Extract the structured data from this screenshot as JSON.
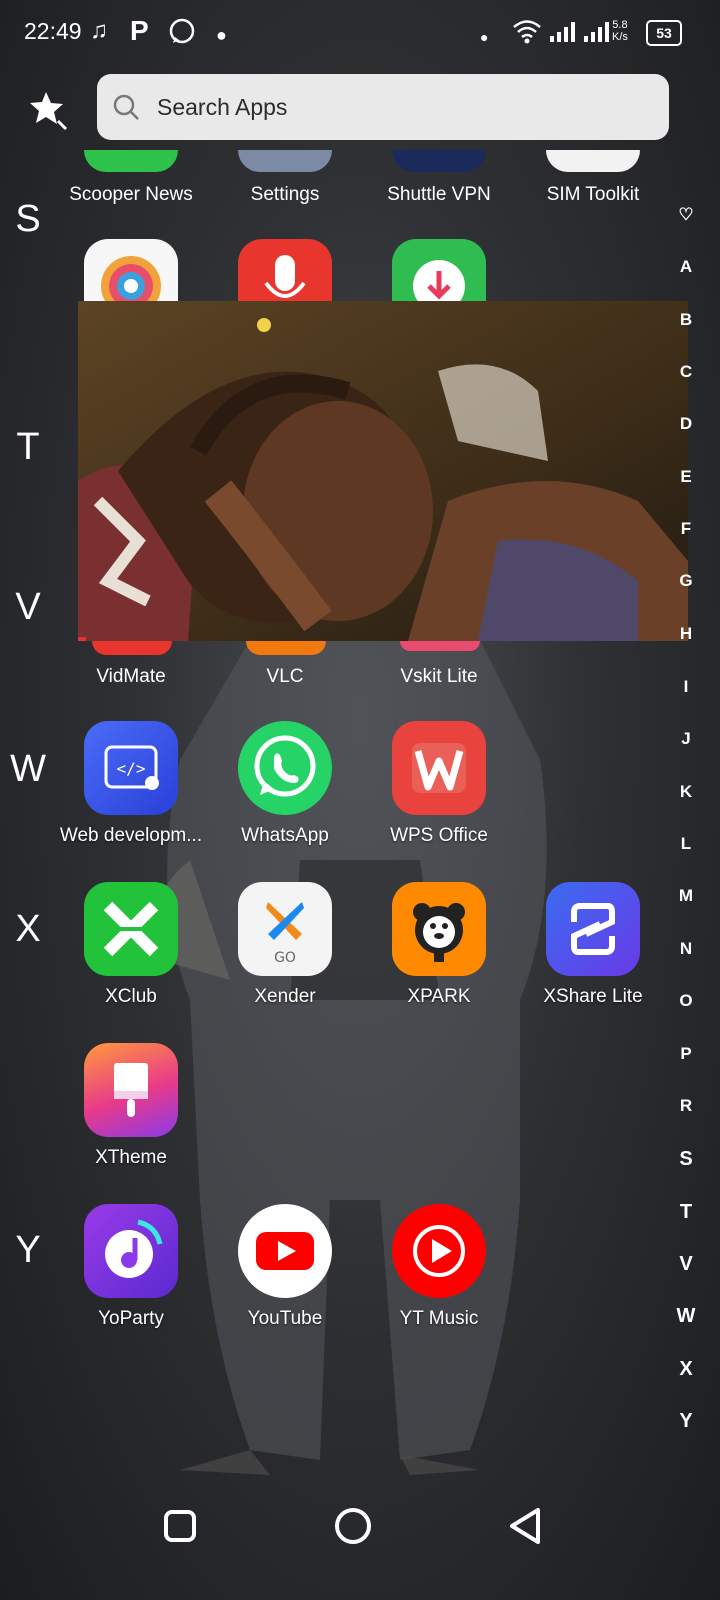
{
  "status_bar": {
    "time": "22:49",
    "net_speed_value": "5.8",
    "net_speed_unit": "K/s",
    "battery": "53"
  },
  "search": {
    "placeholder": "Search Apps"
  },
  "sections": {
    "S": "S",
    "T": "T",
    "V": "V",
    "W": "W",
    "X": "X",
    "Y": "Y"
  },
  "apps": {
    "scooper_news": "Scooper News",
    "settings": "Settings",
    "shuttle_vpn": "Shuttle VPN",
    "sim_toolkit": "SIM Toolkit",
    "vidmate": "VidMate",
    "vlc": "VLC",
    "vskit_lite": "Vskit Lite",
    "web_development": "Web developm...",
    "whatsapp": "WhatsApp",
    "wps_office": "WPS Office",
    "xclub": "XClub",
    "xender": "Xender",
    "xpark": "XPARK",
    "xshare_lite": "XShare Lite",
    "xtheme": "XTheme",
    "yoparty": "YoParty",
    "youtube": "YouTube",
    "yt_music": "YT Music"
  },
  "xender_go": "GO",
  "alphabet_index": [
    "♡",
    "A",
    "B",
    "C",
    "D",
    "E",
    "F",
    "G",
    "H",
    "I",
    "J",
    "K",
    "L",
    "M",
    "N",
    "O",
    "P",
    "R",
    "S",
    "T",
    "V",
    "W",
    "X",
    "Y"
  ],
  "colors": {
    "whatsapp": "#25d366",
    "wps": "#e8433c",
    "youtube": "#ff0000",
    "xclub": "#22c33a",
    "xpark": "#ff8a00",
    "xshare": "#4b5cf0"
  }
}
